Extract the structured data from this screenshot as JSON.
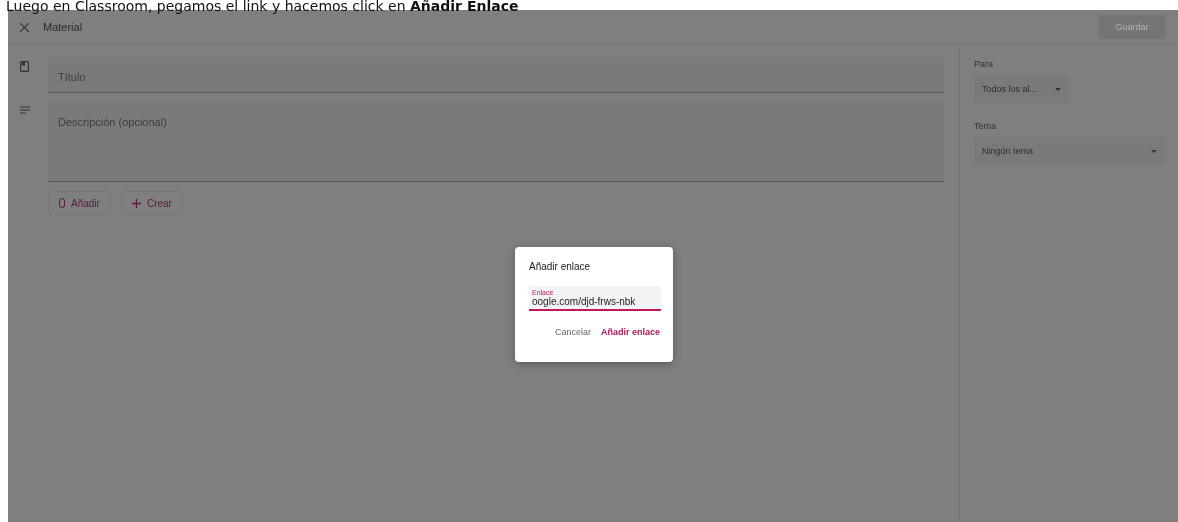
{
  "caption": "Luego en Classroom, pegamos el link y hacemos click en **Añadir Enlace**",
  "header": {
    "title": "Material",
    "save_button": {
      "label": "Guardar",
      "disabled": true
    }
  },
  "form": {
    "title": {
      "placeholder": "Título"
    },
    "description": {
      "placeholder": "Descripción (opcional)"
    },
    "actions": [
      {
        "kind": "attach",
        "label": "Añadir"
      },
      {
        "kind": "create",
        "label": "Crear"
      }
    ]
  },
  "sidebar": {
    "fields": [
      {
        "label": "Para",
        "value": "Todos los al...",
        "wide": false
      },
      {
        "label": "Tema",
        "value": "Ningún tema",
        "wide": true
      }
    ]
  },
  "dialog": {
    "title": "Añadir enlace",
    "field": {
      "label": "Enlace",
      "value": "oogle.com/djd-frws-nbk"
    },
    "buttons": [
      {
        "label": "Cancelar",
        "primary": false
      },
      {
        "label": "Añadir enlace",
        "primary": true
      }
    ]
  }
}
